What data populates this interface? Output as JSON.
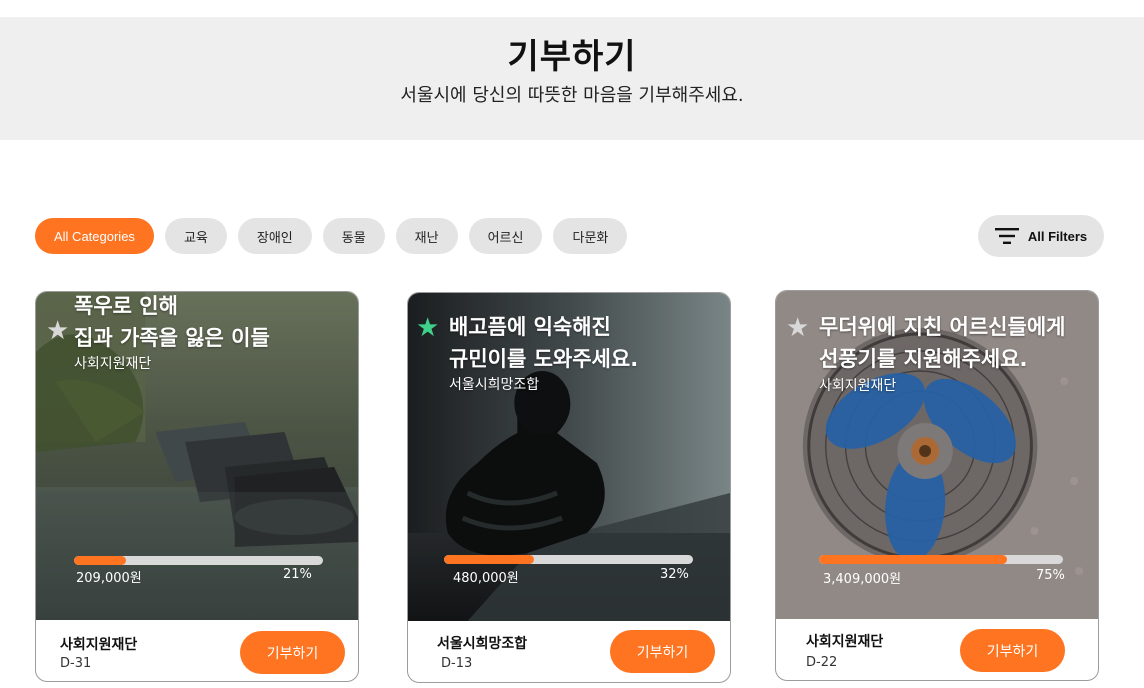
{
  "header": {
    "title": "기부하기",
    "subtitle": "서울시에 당신의 따뜻한 마음을 기부해주세요."
  },
  "categories": {
    "items": [
      "All Categories",
      "교육",
      "장애인",
      "동물",
      "재난",
      "어르신",
      "다문화"
    ],
    "active": "All Categories",
    "filters_label": "All Filters"
  },
  "cards": [
    {
      "title_line1": "폭우로 인해",
      "title_line2": "집과 가족을 잃은 이들",
      "org": "사회지원재단",
      "amount": "209,000원",
      "percent_label": "21%",
      "progress": 0.21,
      "dday": "D-31",
      "button": "기부하기",
      "star_color": "#d8d8d8",
      "image": "flooded-street-with-cars"
    },
    {
      "title_line1": "배고픔에 익숙해진",
      "title_line2": "규민이를 도와주세요.",
      "org": "서울시희망조합",
      "amount": "480,000원",
      "percent_label": "32%",
      "progress": 0.32,
      "dday": "D-13",
      "button": "기부하기",
      "star_color": "#3fd18b",
      "image": "sad-child-sitting-against-wall"
    },
    {
      "title_line1": "무더위에 지친 어르신들에게",
      "title_line2": "선풍기를 지원해주세요.",
      "org": "사회지원재단",
      "amount": "3,409,000원",
      "percent_label": "75%",
      "progress": 0.75,
      "dday": "D-22",
      "button": "기부하기",
      "star_color": "#d8d8d8",
      "image": "electric-fan"
    }
  ],
  "colors": {
    "accent": "#fe7420",
    "chip_bg": "#e4e4e4",
    "hero_bg": "#efefef"
  }
}
